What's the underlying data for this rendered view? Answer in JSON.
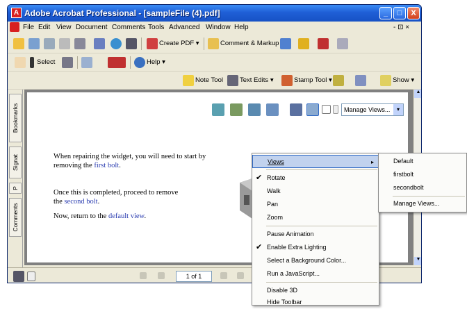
{
  "window": {
    "title": "Adobe Acrobat Professional - [sampleFile (4).pdf]",
    "app_icon": "acrobat-icon",
    "controls": {
      "minimize": "_",
      "maximize": "□",
      "close": "X"
    }
  },
  "menubar": {
    "items": [
      "File",
      "Edit",
      "View",
      "Document",
      "Comments",
      "Tools",
      "Advanced",
      "Window",
      "Help"
    ],
    "doc_controls": "- ⊡ ×"
  },
  "toolbar1": {
    "create_pdf": "Create PDF ▾",
    "comment_markup": "Comment & Markup ▾"
  },
  "toolbar2": {
    "select": "Select",
    "help": "Help ▾"
  },
  "toolbar3": {
    "note_tool": "Note Tool",
    "text_edits": "Text Edits ▾",
    "stamp_tool": "Stamp Tool ▾",
    "show": "Show ▾"
  },
  "sidebar": {
    "tabs": [
      "Bookmarks",
      "Signat",
      "P",
      "Comments"
    ]
  },
  "viewer3d": {
    "manage_views": "Manage Views..."
  },
  "document": {
    "para1_a": "When repairing the widget, you will need to start by",
    "para1_b": "removing the ",
    "link_first_bolt": "first bolt",
    "para1_end": ".",
    "para2_a": "Once this is completed, proceed to remove",
    "para2_b": "the ",
    "link_second_bolt": "second bolt",
    "para2_end": ".",
    "para3_a": "Now, return to the ",
    "link_default_view": "default view",
    "para3_end": "."
  },
  "statusbar": {
    "page_indicator": "1 of 1"
  },
  "context_menu": {
    "views": "Views",
    "rotate": "Rotate",
    "walk": "Walk",
    "pan": "Pan",
    "zoom": "Zoom",
    "pause_animation": "Pause Animation",
    "enable_extra_lighting": "Enable Extra Lighting",
    "select_background": "Select a Background Color...",
    "run_javascript": "Run a JavaScript...",
    "disable_3d": "Disable 3D",
    "hide_toolbar": "Hide Toolbar"
  },
  "submenu": {
    "default": "Default",
    "firstbolt": "firstbolt",
    "secondbolt": "secondbolt",
    "manage_views": "Manage Views..."
  },
  "colors": {
    "titlebar": "#1f5fd6",
    "highlight": "#c1d2ee",
    "link": "#2a3cb0"
  }
}
